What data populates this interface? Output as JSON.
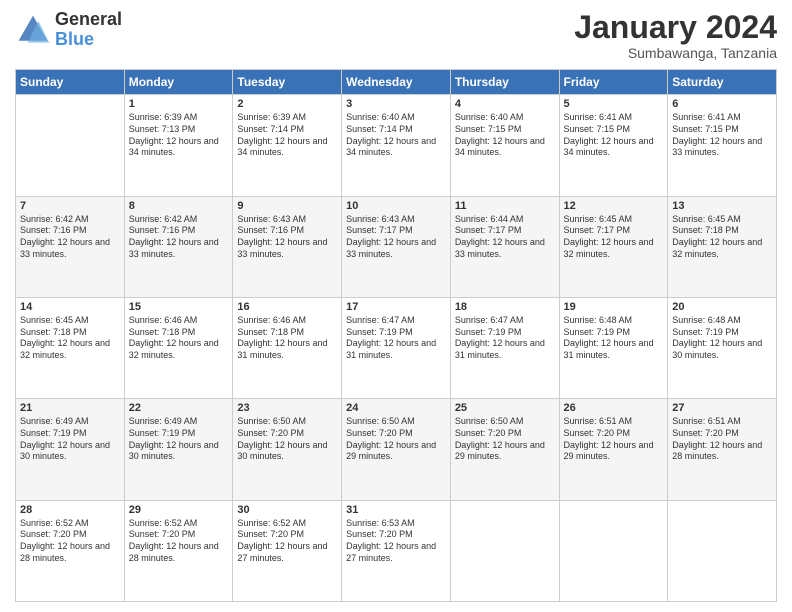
{
  "logo": {
    "general": "General",
    "blue": "Blue"
  },
  "title": "January 2024",
  "subtitle": "Sumbawanga, Tanzania",
  "days": [
    "Sunday",
    "Monday",
    "Tuesday",
    "Wednesday",
    "Thursday",
    "Friday",
    "Saturday"
  ],
  "weeks": [
    [
      {
        "day": "",
        "sunrise": "",
        "sunset": "",
        "daylight": ""
      },
      {
        "day": "1",
        "sunrise": "Sunrise: 6:39 AM",
        "sunset": "Sunset: 7:13 PM",
        "daylight": "Daylight: 12 hours and 34 minutes."
      },
      {
        "day": "2",
        "sunrise": "Sunrise: 6:39 AM",
        "sunset": "Sunset: 7:14 PM",
        "daylight": "Daylight: 12 hours and 34 minutes."
      },
      {
        "day": "3",
        "sunrise": "Sunrise: 6:40 AM",
        "sunset": "Sunset: 7:14 PM",
        "daylight": "Daylight: 12 hours and 34 minutes."
      },
      {
        "day": "4",
        "sunrise": "Sunrise: 6:40 AM",
        "sunset": "Sunset: 7:15 PM",
        "daylight": "Daylight: 12 hours and 34 minutes."
      },
      {
        "day": "5",
        "sunrise": "Sunrise: 6:41 AM",
        "sunset": "Sunset: 7:15 PM",
        "daylight": "Daylight: 12 hours and 34 minutes."
      },
      {
        "day": "6",
        "sunrise": "Sunrise: 6:41 AM",
        "sunset": "Sunset: 7:15 PM",
        "daylight": "Daylight: 12 hours and 33 minutes."
      }
    ],
    [
      {
        "day": "7",
        "sunrise": "Sunrise: 6:42 AM",
        "sunset": "Sunset: 7:16 PM",
        "daylight": "Daylight: 12 hours and 33 minutes."
      },
      {
        "day": "8",
        "sunrise": "Sunrise: 6:42 AM",
        "sunset": "Sunset: 7:16 PM",
        "daylight": "Daylight: 12 hours and 33 minutes."
      },
      {
        "day": "9",
        "sunrise": "Sunrise: 6:43 AM",
        "sunset": "Sunset: 7:16 PM",
        "daylight": "Daylight: 12 hours and 33 minutes."
      },
      {
        "day": "10",
        "sunrise": "Sunrise: 6:43 AM",
        "sunset": "Sunset: 7:17 PM",
        "daylight": "Daylight: 12 hours and 33 minutes."
      },
      {
        "day": "11",
        "sunrise": "Sunrise: 6:44 AM",
        "sunset": "Sunset: 7:17 PM",
        "daylight": "Daylight: 12 hours and 33 minutes."
      },
      {
        "day": "12",
        "sunrise": "Sunrise: 6:45 AM",
        "sunset": "Sunset: 7:17 PM",
        "daylight": "Daylight: 12 hours and 32 minutes."
      },
      {
        "day": "13",
        "sunrise": "Sunrise: 6:45 AM",
        "sunset": "Sunset: 7:18 PM",
        "daylight": "Daylight: 12 hours and 32 minutes."
      }
    ],
    [
      {
        "day": "14",
        "sunrise": "Sunrise: 6:45 AM",
        "sunset": "Sunset: 7:18 PM",
        "daylight": "Daylight: 12 hours and 32 minutes."
      },
      {
        "day": "15",
        "sunrise": "Sunrise: 6:46 AM",
        "sunset": "Sunset: 7:18 PM",
        "daylight": "Daylight: 12 hours and 32 minutes."
      },
      {
        "day": "16",
        "sunrise": "Sunrise: 6:46 AM",
        "sunset": "Sunset: 7:18 PM",
        "daylight": "Daylight: 12 hours and 31 minutes."
      },
      {
        "day": "17",
        "sunrise": "Sunrise: 6:47 AM",
        "sunset": "Sunset: 7:19 PM",
        "daylight": "Daylight: 12 hours and 31 minutes."
      },
      {
        "day": "18",
        "sunrise": "Sunrise: 6:47 AM",
        "sunset": "Sunset: 7:19 PM",
        "daylight": "Daylight: 12 hours and 31 minutes."
      },
      {
        "day": "19",
        "sunrise": "Sunrise: 6:48 AM",
        "sunset": "Sunset: 7:19 PM",
        "daylight": "Daylight: 12 hours and 31 minutes."
      },
      {
        "day": "20",
        "sunrise": "Sunrise: 6:48 AM",
        "sunset": "Sunset: 7:19 PM",
        "daylight": "Daylight: 12 hours and 30 minutes."
      }
    ],
    [
      {
        "day": "21",
        "sunrise": "Sunrise: 6:49 AM",
        "sunset": "Sunset: 7:19 PM",
        "daylight": "Daylight: 12 hours and 30 minutes."
      },
      {
        "day": "22",
        "sunrise": "Sunrise: 6:49 AM",
        "sunset": "Sunset: 7:19 PM",
        "daylight": "Daylight: 12 hours and 30 minutes."
      },
      {
        "day": "23",
        "sunrise": "Sunrise: 6:50 AM",
        "sunset": "Sunset: 7:20 PM",
        "daylight": "Daylight: 12 hours and 30 minutes."
      },
      {
        "day": "24",
        "sunrise": "Sunrise: 6:50 AM",
        "sunset": "Sunset: 7:20 PM",
        "daylight": "Daylight: 12 hours and 29 minutes."
      },
      {
        "day": "25",
        "sunrise": "Sunrise: 6:50 AM",
        "sunset": "Sunset: 7:20 PM",
        "daylight": "Daylight: 12 hours and 29 minutes."
      },
      {
        "day": "26",
        "sunrise": "Sunrise: 6:51 AM",
        "sunset": "Sunset: 7:20 PM",
        "daylight": "Daylight: 12 hours and 29 minutes."
      },
      {
        "day": "27",
        "sunrise": "Sunrise: 6:51 AM",
        "sunset": "Sunset: 7:20 PM",
        "daylight": "Daylight: 12 hours and 28 minutes."
      }
    ],
    [
      {
        "day": "28",
        "sunrise": "Sunrise: 6:52 AM",
        "sunset": "Sunset: 7:20 PM",
        "daylight": "Daylight: 12 hours and 28 minutes."
      },
      {
        "day": "29",
        "sunrise": "Sunrise: 6:52 AM",
        "sunset": "Sunset: 7:20 PM",
        "daylight": "Daylight: 12 hours and 28 minutes."
      },
      {
        "day": "30",
        "sunrise": "Sunrise: 6:52 AM",
        "sunset": "Sunset: 7:20 PM",
        "daylight": "Daylight: 12 hours and 27 minutes."
      },
      {
        "day": "31",
        "sunrise": "Sunrise: 6:53 AM",
        "sunset": "Sunset: 7:20 PM",
        "daylight": "Daylight: 12 hours and 27 minutes."
      },
      {
        "day": "",
        "sunrise": "",
        "sunset": "",
        "daylight": ""
      },
      {
        "day": "",
        "sunrise": "",
        "sunset": "",
        "daylight": ""
      },
      {
        "day": "",
        "sunrise": "",
        "sunset": "",
        "daylight": ""
      }
    ]
  ]
}
